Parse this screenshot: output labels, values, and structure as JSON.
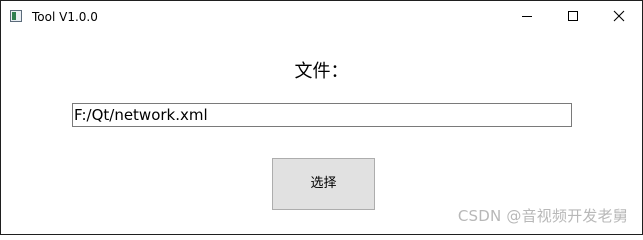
{
  "window": {
    "title": "Tool V1.0.0",
    "icon": "app-icon",
    "controls": [
      "minimize-icon",
      "maximize-icon",
      "close-icon"
    ]
  },
  "main": {
    "file_label": "文件：",
    "path_value": "F:/Qt/network.xml",
    "choose_button_label": "选择"
  },
  "watermark": "CSDN @音视频开发老舅"
}
